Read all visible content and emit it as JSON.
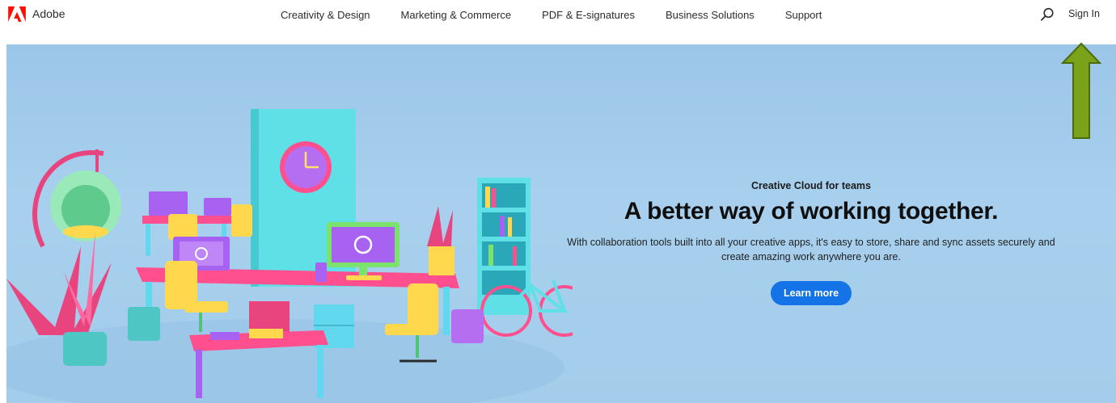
{
  "brand": {
    "name": "Adobe",
    "color": "#fa0f00"
  },
  "nav": {
    "items": [
      {
        "label": "Creativity & Design"
      },
      {
        "label": "Marketing & Commerce"
      },
      {
        "label": "PDF & E-signatures"
      },
      {
        "label": "Business Solutions"
      },
      {
        "label": "Support"
      }
    ],
    "search_icon": "search-icon",
    "sign_in_label": "Sign In"
  },
  "hero": {
    "eyebrow": "Creative Cloud for teams",
    "headline": "A better way of working together.",
    "body": "With collaboration tools built into all your creative apps, it's easy to store, share and sync assets securely and create amazing work anywhere you are.",
    "cta_label": "Learn more",
    "cta_color": "#1473e6",
    "background_color": "#a6cdec"
  },
  "annotation": {
    "icon": "up-arrow-icon",
    "color": "#7aa319"
  }
}
